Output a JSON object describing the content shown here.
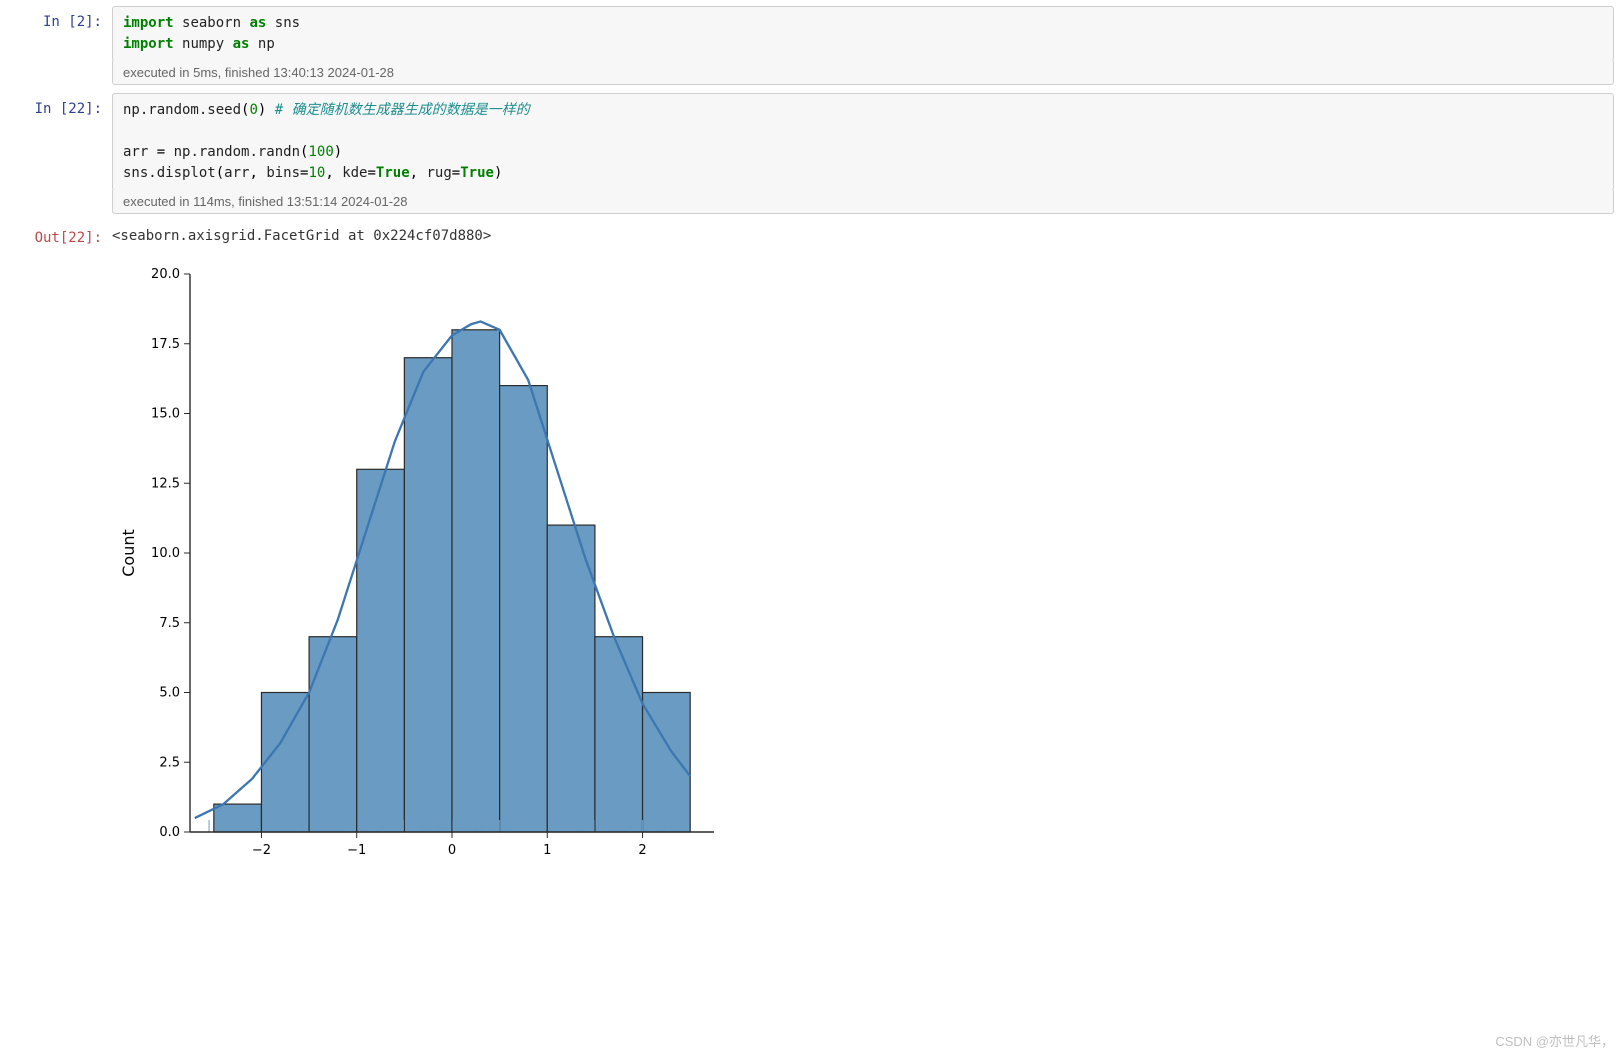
{
  "cells": {
    "c0": {
      "prompt": "In  [2]:",
      "code_html": "<span class='kw'>import</span> <span class='nm'>seaborn</span> <span class='kw'>as</span> <span class='nm'>sns</span>\n<span class='kw'>import</span> <span class='nm'>numpy</span> <span class='kw'>as</span> <span class='nm'>np</span>",
      "status": "executed in 5ms, finished 13:40:13 2024-01-28"
    },
    "c1": {
      "prompt": "In  [22]:",
      "code_html": "<span class='nm'>np.random.seed</span>(<span class='num'>0</span>) <span class='cm'># 确定随机数生成器生成的数据是一样的</span>\n\n<span class='nm'>arr</span> = <span class='nm'>np.random.randn</span>(<span class='num'>100</span>)\n<span class='nm'>sns.displot</span>(<span class='nm'>arr</span>, <span class='nm'>bins</span>=<span class='num'>10</span>, <span class='nm'>kde</span>=<span class='bval'>True</span>, <span class='nm'>rug</span>=<span class='bval'>True</span>)",
      "status": "executed in 114ms, finished 13:51:14 2024-01-28"
    },
    "out": {
      "prompt": "Out[22]:",
      "text": "<seaborn.axisgrid.FacetGrid at 0x224cf07d880>"
    }
  },
  "watermark": "CSDN @亦世凡华，",
  "chart_data": {
    "type": "bar",
    "categories_edges": [
      -2.5,
      -2.0,
      -1.5,
      -1.0,
      -0.5,
      0.0,
      0.5,
      1.0,
      1.5,
      2.0,
      2.5
    ],
    "values": [
      1,
      5,
      7,
      13,
      17,
      18,
      16,
      11,
      7,
      5
    ],
    "ylabel": "Count",
    "xlabel": "",
    "xlim": [
      -2.75,
      2.75
    ],
    "ylim": [
      0,
      20
    ],
    "xticks": [
      -2,
      -1,
      0,
      1,
      2
    ],
    "yticks": [
      0.0,
      2.5,
      5.0,
      7.5,
      10.0,
      12.5,
      15.0,
      17.5,
      20.0
    ],
    "kde": [
      {
        "x": -2.7,
        "y": 0.5
      },
      {
        "x": -2.4,
        "y": 1.0
      },
      {
        "x": -2.1,
        "y": 1.9
      },
      {
        "x": -1.8,
        "y": 3.2
      },
      {
        "x": -1.5,
        "y": 5.0
      },
      {
        "x": -1.2,
        "y": 7.6
      },
      {
        "x": -0.9,
        "y": 10.8
      },
      {
        "x": -0.6,
        "y": 14.0
      },
      {
        "x": -0.3,
        "y": 16.5
      },
      {
        "x": 0.0,
        "y": 17.8
      },
      {
        "x": 0.2,
        "y": 18.2
      },
      {
        "x": 0.3,
        "y": 18.3
      },
      {
        "x": 0.5,
        "y": 18.0
      },
      {
        "x": 0.8,
        "y": 16.2
      },
      {
        "x": 1.1,
        "y": 13.0
      },
      {
        "x": 1.4,
        "y": 9.8
      },
      {
        "x": 1.7,
        "y": 7.0
      },
      {
        "x": 2.0,
        "y": 4.6
      },
      {
        "x": 2.3,
        "y": 2.9
      },
      {
        "x": 2.5,
        "y": 2.0
      }
    ],
    "rug": [
      -2.55,
      -1.98,
      -1.87,
      -1.71,
      -1.63,
      -1.55,
      -1.45,
      -1.31,
      -1.25,
      -1.18,
      -1.1,
      -1.05,
      -0.98,
      -0.97,
      -0.91,
      -0.85,
      -0.8,
      -0.74,
      -0.72,
      -0.67,
      -0.63,
      -0.58,
      -0.56,
      -0.51,
      -0.48,
      -0.44,
      -0.4,
      -0.38,
      -0.35,
      -0.31,
      -0.29,
      -0.27,
      -0.25,
      -0.21,
      -0.19,
      -0.15,
      -0.12,
      -0.1,
      -0.08,
      -0.05,
      -0.02,
      0.01,
      0.04,
      0.05,
      0.08,
      0.1,
      0.12,
      0.14,
      0.15,
      0.18,
      0.21,
      0.23,
      0.26,
      0.29,
      0.33,
      0.36,
      0.38,
      0.4,
      0.41,
      0.44,
      0.47,
      0.5,
      0.55,
      0.58,
      0.62,
      0.65,
      0.68,
      0.71,
      0.76,
      0.79,
      0.82,
      0.86,
      0.89,
      0.95,
      0.98,
      1.03,
      1.07,
      1.13,
      1.18,
      1.22,
      1.27,
      1.33,
      1.4,
      1.45,
      1.49,
      1.53,
      1.58,
      1.62,
      1.76,
      1.86,
      1.87,
      1.89,
      1.95,
      2.0,
      2.05,
      2.1,
      2.14,
      2.24,
      2.27,
      2.38
    ],
    "colors": {
      "bar_fill": "#6A9BC3",
      "bar_edge": "#2b2b2b",
      "kde": "#3C77B2",
      "axis": "#2b2b2b"
    }
  }
}
